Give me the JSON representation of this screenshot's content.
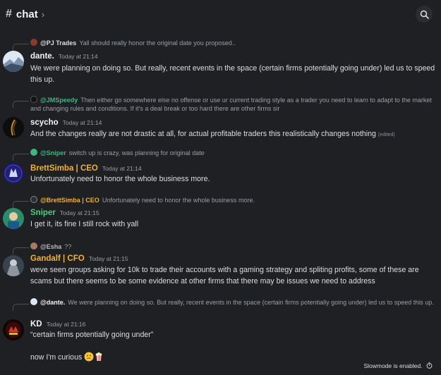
{
  "header": {
    "hash": "#",
    "title": "chat",
    "chevron": "›",
    "search_icon": "search-icon"
  },
  "messages": [
    {
      "reply": {
        "mention": "@PJ Trades",
        "text": "Yall should really honor the original date you proposed.."
      },
      "author": "dante.",
      "author_color": "#f2f3f5",
      "timestamp": "Today at 21:14",
      "text": "We were planning on doing so. But really, recent events in the space (certain firms potentially going under) led us to speed this up."
    },
    {
      "reply": {
        "mention": "@JMSpeedy",
        "mention_color": "#43b581",
        "text": "Then either go somewhere else no offense or use ur current trading style as a trader you need to learn to adapt to the market and changing rules and conditions. If it's a deal break or too hard there are other firms sir"
      },
      "author": "scycho",
      "author_color": "#f2f3f5",
      "timestamp": "Today at 21:14",
      "text": "And the changes really are not drastic at all, for actual profitable traders this realistically changes nothing",
      "edited": "(edited)"
    },
    {
      "reply": {
        "mention": "@Sniper",
        "mention_color": "#43b581",
        "text": "switch up is crazy, was planning for original date"
      },
      "author": "BrettSimba | CEO",
      "author_color": "#f0b232",
      "timestamp": "Today at 21:14",
      "text": "Unfortunately need to honor the whole business more."
    },
    {
      "reply": {
        "mention": "@BrettSimba | CEO",
        "mention_color": "#f0b232",
        "text": "Unfortunately need to honor the whole business more."
      },
      "author": "Sniper",
      "author_color": "#43d17a",
      "timestamp": "Today at 21:15",
      "text": "I get it, its fine I still rock with yall"
    },
    {
      "reply": {
        "mention": "@Esha",
        "mention_color": "#b5bac1",
        "text": "??"
      },
      "author": "Gandalf | CFO",
      "author_color": "#f0b232",
      "timestamp": "Today at 21:15",
      "text": "weve seen groups asking for 10k to trade their accounts with a gaming strategy and spliting profits, some of these are scams but there seems to be some evidence at other firms that there may be issues we need to address"
    },
    {
      "reply": {
        "mention": "@dante.",
        "mention_color": "#f2f3f5",
        "text": "We were planning on doing so. But really, recent events in the space (certain firms potentially going under) led us to speed this up."
      },
      "author": "KD",
      "author_color": "#f2f3f5",
      "timestamp": "Today at 21:16",
      "text": "“certain firms potentially going under”",
      "text2": "now I'm curious"
    }
  ],
  "footer": {
    "slowmode": "Slowmode is enabled."
  }
}
